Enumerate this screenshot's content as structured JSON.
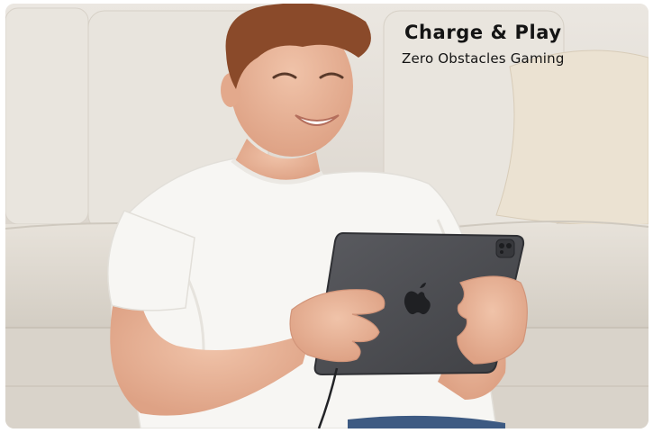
{
  "banner": {
    "headline": "Charge & Play",
    "subline": "Zero Obstacles Gaming"
  },
  "colors": {
    "sofa": "#e6e1da",
    "cushion": "#ece4d6",
    "shirt": "#f7f6f3",
    "skin": "#e8b49a",
    "hair": "#8a4a2a",
    "tablet": "#4c4d52",
    "text": "#141414"
  },
  "icons": {
    "tablet_logo": "apple-logo-icon",
    "camera": "camera-module-icon"
  }
}
